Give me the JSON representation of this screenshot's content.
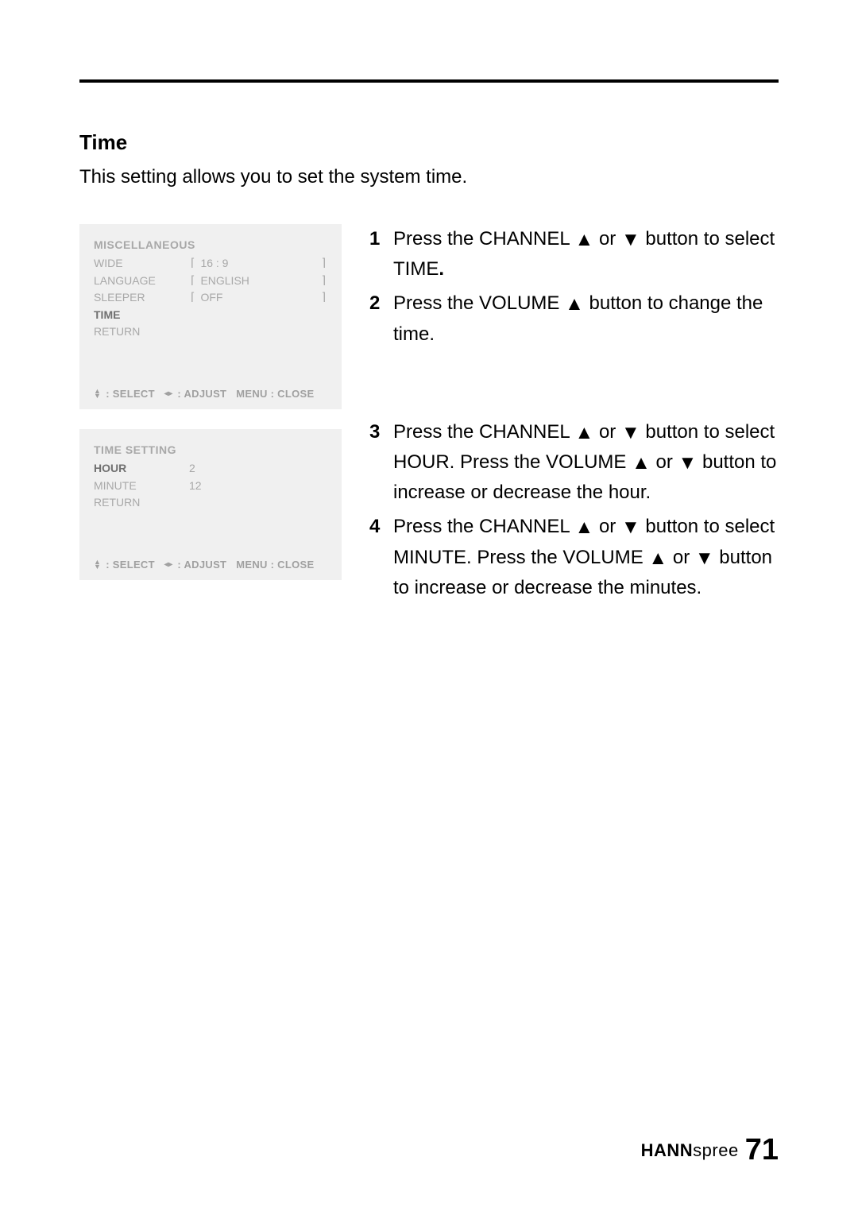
{
  "title": "Time",
  "description": "This setting allows you to set the system time.",
  "osd1": {
    "title": "MISCELLANEOUS",
    "rows": [
      {
        "label": "WIDE",
        "value": "16 : 9",
        "brackets": true
      },
      {
        "label": "LANGUAGE",
        "value": "ENGLISH",
        "brackets": true
      },
      {
        "label": "SLEEPER",
        "value": "OFF",
        "brackets": true
      },
      {
        "label": "TIME",
        "active": true
      },
      {
        "label": "RETURN"
      }
    ],
    "footer": {
      "select": ": SELECT",
      "adjust": ": ADJUST",
      "menu": "MENU : CLOSE"
    }
  },
  "osd2": {
    "title": "TIME SETTING",
    "rows": [
      {
        "label": "HOUR",
        "value": "2",
        "active": true
      },
      {
        "label": "MINUTE",
        "value": "12"
      },
      {
        "label": "RETURN"
      }
    ],
    "footer": {
      "select": ": SELECT",
      "adjust": ": ADJUST",
      "menu": "MENU : CLOSE"
    }
  },
  "steps": [
    {
      "n": "1",
      "t1": "Press the CHANNEL ",
      "t2": " or ",
      "t3": " button to select TIME",
      "period": "."
    },
    {
      "n": "2",
      "t1": "Press the VOLUME ",
      "t3": " button to change the time."
    },
    {
      "n": "3",
      "t1": "Press the CHANNEL ",
      "t2": " or ",
      "t3": " button to select HOUR. Press the VOLUME ",
      "t4": " or ",
      "t5": " button to increase or decrease the hour."
    },
    {
      "n": "4",
      "t1": "Press the CHANNEL ",
      "t2": " or ",
      "t3": " button to select MINUTE. Press the VOLUME ",
      "t4": " or ",
      "t5": " button to increase or decrease the minutes."
    }
  ],
  "footer": {
    "brand_bold": "HANN",
    "brand_light": "spree",
    "page": "71"
  },
  "icons": {
    "up": "▲",
    "down": "▼",
    "left": "◂",
    "right": "▸"
  }
}
